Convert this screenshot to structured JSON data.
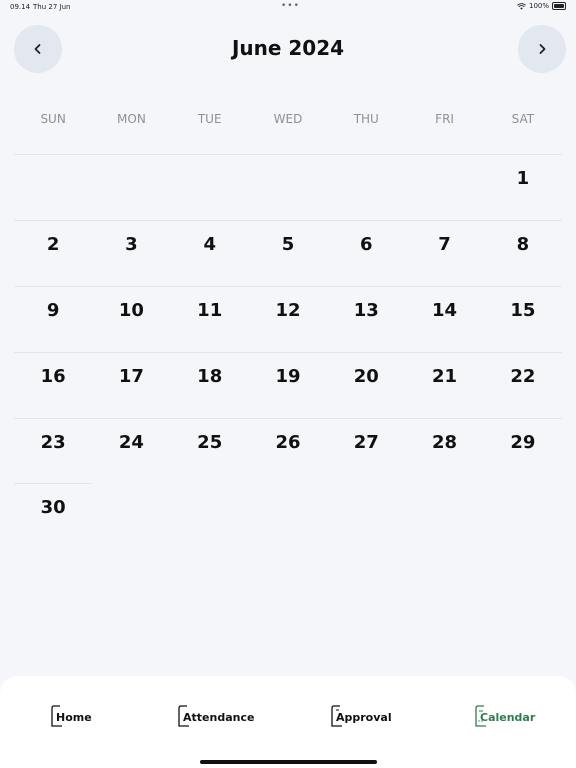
{
  "status_bar": {
    "time": "09.14",
    "date": "Thu 27 Jun",
    "battery": "100%"
  },
  "header": {
    "title": "June 2024"
  },
  "weekdays": [
    "SUN",
    "MON",
    "TUE",
    "WED",
    "THU",
    "FRI",
    "SAT"
  ],
  "weeks": [
    [
      "",
      "",
      "",
      "",
      "",
      "",
      "1"
    ],
    [
      "2",
      "3",
      "4",
      "5",
      "6",
      "7",
      "8"
    ],
    [
      "9",
      "10",
      "11",
      "12",
      "13",
      "14",
      "15"
    ],
    [
      "16",
      "17",
      "18",
      "19",
      "20",
      "21",
      "22"
    ],
    [
      "23",
      "24",
      "25",
      "26",
      "27",
      "28",
      "29"
    ],
    [
      "30",
      "",
      "",
      "",
      "",
      "",
      ""
    ]
  ],
  "tabs": [
    {
      "label": "Home",
      "icon": "home-icon"
    },
    {
      "label": "Attendance",
      "icon": "attendance-icon"
    },
    {
      "label": "Approval",
      "icon": "approval-icon"
    },
    {
      "label": "Calendar",
      "icon": "calendar-icon",
      "active": true
    }
  ],
  "colors": {
    "accent": "#2e7d4f",
    "background": "#f4f6fa",
    "nav_button": "#e3e7ef"
  }
}
